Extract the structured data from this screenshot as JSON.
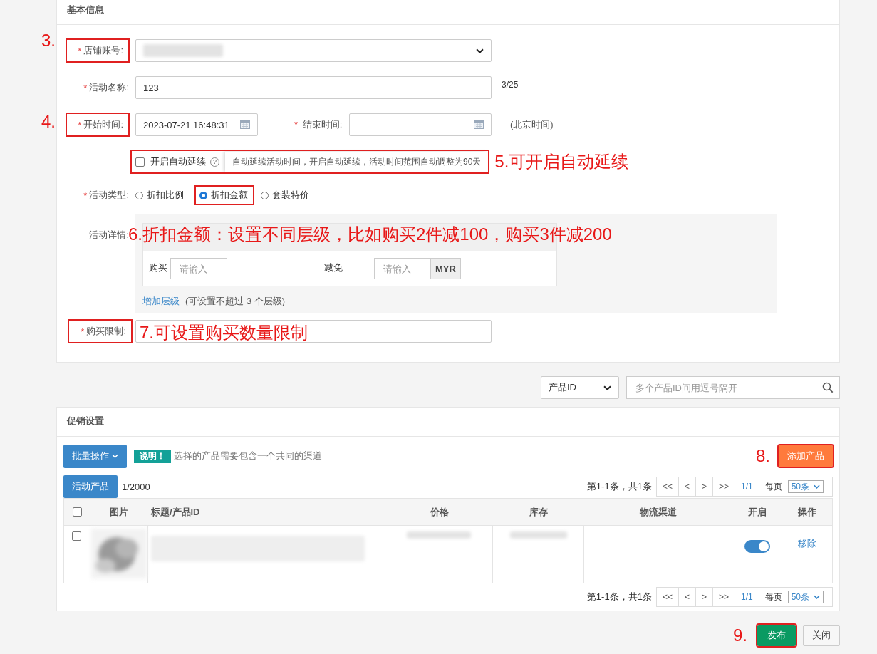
{
  "basic_info": {
    "title": "基本信息",
    "store_account": {
      "mark": "*",
      "label": "店铺账号:",
      "annotation": "3."
    },
    "activity_name": {
      "mark": "*",
      "label": "活动名称:",
      "value": "123",
      "count": "3/25"
    },
    "start_time": {
      "mark": "*",
      "label": "开始时间:",
      "value": "2023-07-21 16:48:31",
      "annotation": "4."
    },
    "end_time": {
      "mark": "*",
      "label": "结束时间:"
    },
    "timezone": "(北京时间)",
    "auto_extend": {
      "label": "开启自动延续",
      "checked": false,
      "help": "?",
      "tooltip": "自动延续活动时间，开启自动延续，活动时间范围自动调整为90天",
      "annotation": "5.可开启自动延续"
    },
    "activity_type": {
      "mark": "*",
      "label": "活动类型:",
      "options": [
        {
          "label": "折扣比例",
          "selected": false
        },
        {
          "label": "折扣金额",
          "selected": true
        },
        {
          "label": "套装特价",
          "selected": false
        }
      ]
    },
    "activity_detail": {
      "label": "活动详情:",
      "annotation": "6.折扣金额：设置不同层级，比如购买2件减100，购买3件减200",
      "buy_label": "购买",
      "buy_placeholder": "请输入",
      "reduce_label": "减免",
      "reduce_placeholder": "请输入",
      "currency": "MYR",
      "add_tier": "增加层级",
      "add_tier_note": "(可设置不超过 3 个层级)"
    },
    "purchase_limit": {
      "mark": "*",
      "label": "购买限制:",
      "annotation": "7.可设置购买数量限制"
    }
  },
  "search": {
    "field": "产品ID",
    "placeholder": "多个产品ID间用逗号隔开"
  },
  "promotion": {
    "title": "促销设置",
    "batch_button": "批量操作",
    "notice_tag": "说明！",
    "notice": "选择的产品需要包含一个共同的渠道",
    "add_annotation": "8.",
    "add_button": "添加产品",
    "tab": "活动产品",
    "count": "1/2000",
    "pager_top": {
      "summary": "第1-1条，共1条",
      "buttons": [
        "<<",
        "<",
        ">",
        ">>"
      ],
      "page": "1/1",
      "per_page_label": "每页",
      "per_page": "50条"
    },
    "header_checked": false,
    "columns": [
      "图片",
      "标题/产品ID",
      "价格",
      "库存",
      "物流渠道",
      "开启",
      "操作"
    ],
    "rows": [
      {
        "checked": false,
        "on": true,
        "action": "移除"
      }
    ],
    "pager_bottom": {
      "summary": "第1-1条，共1条",
      "buttons": [
        "<<",
        "<",
        ">",
        ">>"
      ],
      "page": "1/1",
      "per_page_label": "每页",
      "per_page": "50条"
    }
  },
  "footer": {
    "annotation": "9.",
    "publish": "发布",
    "close": "关闭"
  }
}
